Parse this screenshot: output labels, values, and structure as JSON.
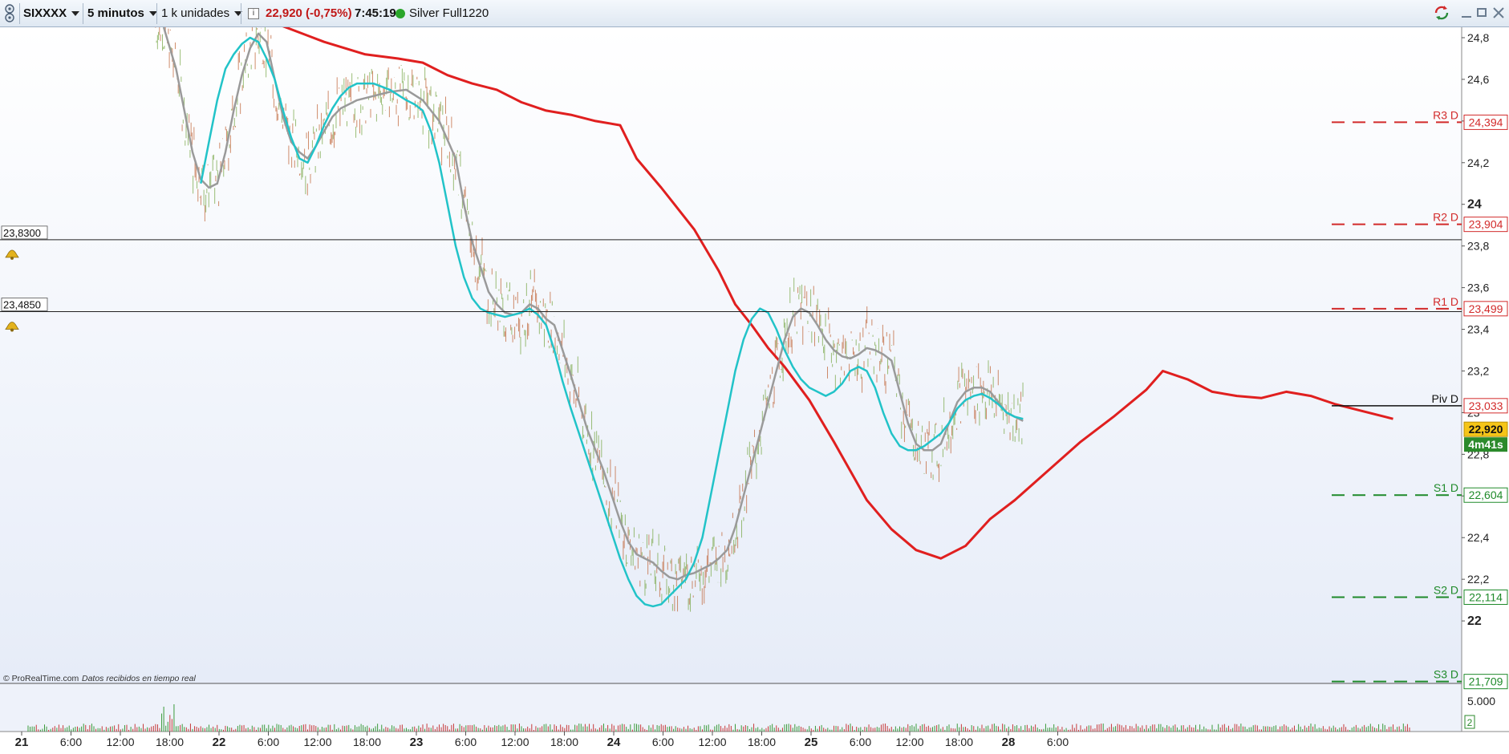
{
  "toolbar": {
    "logo_icon": "prorealtime-logo-icon",
    "symbol": "SIXXXX",
    "timeframe": "5 minutos",
    "units": "1 k unidades",
    "info_icon": "info-icon",
    "price_change": "22,920 (-0,75%)",
    "time": "7:45:19",
    "status_icon": "green-dot-icon",
    "account": "Silver Full1220",
    "window_icons": [
      "refresh-icon",
      "minimize-icon",
      "maximize-icon",
      "close-icon"
    ]
  },
  "colors": {
    "chart_bg_top": "#ffffff",
    "chart_bg_bottom": "#e8edf9",
    "red_ma": "#e01f1f",
    "gray_ma": "#9a9a9a",
    "cyan_ma": "#22c3c8",
    "dotted_ma": "#1a1aa8",
    "resistance": "#d22a2a",
    "support": "#1f8a2a",
    "price_badge": "#f5c518",
    "countdown_badge": "#2b8a2b",
    "negative_change": "#c01616"
  },
  "chart_data": {
    "type": "line",
    "title": "",
    "x_labels": [
      "21",
      "6:00",
      "12:00",
      "18:00",
      "22",
      "6:00",
      "12:00",
      "18:00",
      "23",
      "6:00",
      "12:00",
      "18:00",
      "24",
      "6:00",
      "12:00",
      "18:00",
      "25",
      "6:00",
      "12:00",
      "18:00",
      "28",
      "6:00"
    ],
    "bold_x_labels": [
      "21",
      "22",
      "23",
      "24",
      "25",
      "28"
    ],
    "y_ticks": [
      "24,8",
      "24,6",
      "24,4",
      "24,2",
      "24",
      "23,8",
      "23,6",
      "23,4",
      "23,2",
      "23",
      "22,8",
      "22,6",
      "22,4",
      "22,2",
      "22"
    ],
    "ylim": [
      21.7,
      24.85
    ],
    "x_range_hours": [
      0,
      171
    ],
    "series": [
      {
        "key": "red",
        "style": "solid",
        "values": [
          [
            15.5,
            25.6
          ],
          [
            16.5,
            25.4
          ],
          [
            19,
            25.2
          ],
          [
            23,
            24.98
          ],
          [
            27,
            24.92
          ],
          [
            30,
            24.87
          ],
          [
            36,
            24.78
          ],
          [
            41,
            24.72
          ],
          [
            45,
            24.7
          ],
          [
            48,
            24.68
          ],
          [
            51,
            24.62
          ],
          [
            54,
            24.58
          ],
          [
            57,
            24.55
          ],
          [
            60,
            24.49
          ],
          [
            63,
            24.45
          ],
          [
            66,
            24.43
          ],
          [
            69,
            24.4
          ],
          [
            72,
            24.38
          ],
          [
            74,
            24.22
          ],
          [
            77,
            24.08
          ],
          [
            79,
            23.98
          ],
          [
            81,
            23.88
          ],
          [
            84,
            23.68
          ],
          [
            86,
            23.52
          ],
          [
            88,
            23.42
          ],
          [
            90,
            23.31
          ],
          [
            92,
            23.22
          ],
          [
            95,
            23.06
          ],
          [
            98,
            22.86
          ],
          [
            100,
            22.72
          ],
          [
            102,
            22.58
          ],
          [
            105,
            22.44
          ],
          [
            108,
            22.34
          ],
          [
            111,
            22.3
          ],
          [
            114,
            22.36
          ],
          [
            117,
            22.49
          ],
          [
            120,
            22.58
          ],
          [
            124,
            22.72
          ],
          [
            128,
            22.86
          ],
          [
            132,
            22.98
          ],
          [
            136,
            23.11
          ],
          [
            138,
            23.2
          ],
          [
            141,
            23.16
          ],
          [
            144,
            23.1
          ],
          [
            147,
            23.08
          ],
          [
            150,
            23.07
          ],
          [
            153,
            23.1
          ],
          [
            156,
            23.08
          ],
          [
            159,
            23.04
          ],
          [
            162,
            23.01
          ],
          [
            165,
            22.98
          ],
          [
            166,
            22.97
          ]
        ]
      },
      {
        "key": "gray",
        "style": "solid",
        "values": [
          [
            16.5,
            24.85
          ],
          [
            18,
            24.65
          ],
          [
            19,
            24.45
          ],
          [
            20,
            24.25
          ],
          [
            21,
            24.12
          ],
          [
            22,
            24.08
          ],
          [
            23,
            24.1
          ],
          [
            24,
            24.25
          ],
          [
            25,
            24.45
          ],
          [
            26,
            24.62
          ],
          [
            27,
            24.75
          ],
          [
            28,
            24.82
          ],
          [
            29,
            24.78
          ],
          [
            30,
            24.6
          ],
          [
            31,
            24.42
          ],
          [
            32,
            24.3
          ],
          [
            33,
            24.25
          ],
          [
            34,
            24.22
          ],
          [
            35,
            24.28
          ],
          [
            36,
            24.35
          ],
          [
            37,
            24.42
          ],
          [
            38,
            24.46
          ],
          [
            40,
            24.5
          ],
          [
            42,
            24.52
          ],
          [
            44,
            24.54
          ],
          [
            46,
            24.55
          ],
          [
            48,
            24.5
          ],
          [
            50,
            24.4
          ],
          [
            52,
            24.22
          ],
          [
            53,
            24.0
          ],
          [
            54,
            23.82
          ],
          [
            55,
            23.7
          ],
          [
            56,
            23.58
          ],
          [
            57,
            23.52
          ],
          [
            58,
            23.48
          ],
          [
            59,
            23.47
          ],
          [
            60,
            23.48
          ],
          [
            61,
            23.52
          ],
          [
            62,
            23.5
          ],
          [
            63,
            23.45
          ],
          [
            64,
            23.42
          ],
          [
            65,
            23.3
          ],
          [
            66,
            23.18
          ],
          [
            67,
            23.05
          ],
          [
            68,
            22.92
          ],
          [
            69,
            22.82
          ],
          [
            70,
            22.72
          ],
          [
            71,
            22.6
          ],
          [
            72,
            22.48
          ],
          [
            73,
            22.38
          ],
          [
            74,
            22.32
          ],
          [
            75,
            22.3
          ],
          [
            76,
            22.28
          ],
          [
            77,
            22.24
          ],
          [
            78,
            22.21
          ],
          [
            79,
            22.2
          ],
          [
            80,
            22.22
          ],
          [
            81,
            22.23
          ],
          [
            82,
            22.25
          ],
          [
            83,
            22.27
          ],
          [
            84,
            22.3
          ],
          [
            85,
            22.34
          ],
          [
            86,
            22.45
          ],
          [
            87,
            22.6
          ],
          [
            88,
            22.75
          ],
          [
            89,
            22.9
          ],
          [
            90,
            23.05
          ],
          [
            91,
            23.2
          ],
          [
            92,
            23.35
          ],
          [
            93,
            23.46
          ],
          [
            94,
            23.5
          ],
          [
            95,
            23.48
          ],
          [
            96,
            23.42
          ],
          [
            97,
            23.35
          ],
          [
            98,
            23.3
          ],
          [
            99,
            23.27
          ],
          [
            100,
            23.26
          ],
          [
            101,
            23.28
          ],
          [
            102,
            23.31
          ],
          [
            103,
            23.3
          ],
          [
            104,
            23.28
          ],
          [
            105,
            23.25
          ],
          [
            106,
            23.1
          ],
          [
            107,
            22.95
          ],
          [
            108,
            22.85
          ],
          [
            109,
            22.82
          ],
          [
            110,
            22.82
          ],
          [
            111,
            22.85
          ],
          [
            112,
            22.95
          ],
          [
            113,
            23.05
          ],
          [
            114,
            23.1
          ],
          [
            115,
            23.12
          ],
          [
            116,
            23.12
          ],
          [
            117,
            23.1
          ],
          [
            118,
            23.05
          ],
          [
            119,
            23.0
          ],
          [
            120,
            22.98
          ],
          [
            121,
            22.96
          ]
        ]
      },
      {
        "key": "cyan",
        "style": "solid",
        "values": [
          [
            21,
            24.1
          ],
          [
            22,
            24.3
          ],
          [
            23,
            24.5
          ],
          [
            24,
            24.65
          ],
          [
            25,
            24.72
          ],
          [
            26,
            24.77
          ],
          [
            27,
            24.8
          ],
          [
            28,
            24.78
          ],
          [
            29,
            24.7
          ],
          [
            30,
            24.6
          ],
          [
            31,
            24.45
          ],
          [
            32,
            24.32
          ],
          [
            33,
            24.22
          ],
          [
            34,
            24.2
          ],
          [
            35,
            24.28
          ],
          [
            36,
            24.38
          ],
          [
            37,
            24.46
          ],
          [
            38,
            24.52
          ],
          [
            39,
            24.56
          ],
          [
            40,
            24.58
          ],
          [
            42,
            24.58
          ],
          [
            44,
            24.55
          ],
          [
            46,
            24.5
          ],
          [
            47,
            24.48
          ],
          [
            48,
            24.45
          ],
          [
            49,
            24.35
          ],
          [
            50,
            24.2
          ],
          [
            51,
            24.0
          ],
          [
            52,
            23.8
          ],
          [
            53,
            23.65
          ],
          [
            54,
            23.55
          ],
          [
            55,
            23.5
          ],
          [
            56,
            23.48
          ],
          [
            57,
            23.47
          ],
          [
            58,
            23.46
          ],
          [
            59,
            23.47
          ],
          [
            60,
            23.48
          ],
          [
            61,
            23.5
          ],
          [
            62,
            23.47
          ],
          [
            63,
            23.42
          ],
          [
            64,
            23.3
          ],
          [
            65,
            23.15
          ],
          [
            66,
            23.02
          ],
          [
            67,
            22.9
          ],
          [
            68,
            22.78
          ],
          [
            69,
            22.66
          ],
          [
            70,
            22.54
          ],
          [
            71,
            22.42
          ],
          [
            72,
            22.3
          ],
          [
            73,
            22.2
          ],
          [
            74,
            22.12
          ],
          [
            75,
            22.08
          ],
          [
            76,
            22.07
          ],
          [
            77,
            22.08
          ],
          [
            78,
            22.12
          ],
          [
            79,
            22.16
          ],
          [
            80,
            22.2
          ],
          [
            81,
            22.28
          ],
          [
            82,
            22.4
          ],
          [
            83,
            22.6
          ],
          [
            84,
            22.8
          ],
          [
            85,
            23.0
          ],
          [
            86,
            23.2
          ],
          [
            87,
            23.35
          ],
          [
            88,
            23.45
          ],
          [
            89,
            23.5
          ],
          [
            90,
            23.48
          ],
          [
            91,
            23.4
          ],
          [
            92,
            23.3
          ],
          [
            93,
            23.22
          ],
          [
            94,
            23.16
          ],
          [
            95,
            23.12
          ],
          [
            96,
            23.1
          ],
          [
            97,
            23.08
          ],
          [
            98,
            23.1
          ],
          [
            99,
            23.14
          ],
          [
            100,
            23.2
          ],
          [
            101,
            23.22
          ],
          [
            102,
            23.2
          ],
          [
            103,
            23.12
          ],
          [
            104,
            23.0
          ],
          [
            105,
            22.9
          ],
          [
            106,
            22.84
          ],
          [
            107,
            22.82
          ],
          [
            108,
            22.82
          ],
          [
            109,
            22.84
          ],
          [
            110,
            22.87
          ],
          [
            111,
            22.9
          ],
          [
            112,
            22.95
          ],
          [
            113,
            23.02
          ],
          [
            114,
            23.06
          ],
          [
            115,
            23.08
          ],
          [
            116,
            23.09
          ],
          [
            117,
            23.07
          ],
          [
            118,
            23.04
          ],
          [
            119,
            23.0
          ],
          [
            120,
            22.98
          ],
          [
            121,
            22.97
          ]
        ]
      }
    ],
    "horizontal_lines": [
      {
        "label": "23,8300",
        "value": 23.83
      },
      {
        "label": "23,4850",
        "value": 23.485
      }
    ],
    "pivot_levels": [
      {
        "name": "R3 D",
        "value": 24.394,
        "label": "24,394",
        "color_key": "resistance"
      },
      {
        "name": "R2 D",
        "value": 23.904,
        "label": "23,904",
        "color_key": "resistance"
      },
      {
        "name": "R1 D",
        "value": 23.499,
        "label": "23,499",
        "color_key": "resistance"
      },
      {
        "name": "Piv D",
        "value": 23.033,
        "label": "23,033",
        "color_key": "resistance"
      },
      {
        "name": "S1 D",
        "value": 22.604,
        "label": "22,604",
        "color_key": "support"
      },
      {
        "name": "S2 D",
        "value": 22.114,
        "label": "22,114",
        "color_key": "support"
      },
      {
        "name": "S3 D",
        "value": 21.709,
        "label": "21,709",
        "color_key": "support"
      }
    ],
    "last_price_label": "22,920",
    "last_price_value": 22.92,
    "countdown": "4m41s",
    "volume_tick": "5.000",
    "volume_small_badge": "2",
    "copyright": "© ProRealTime.com",
    "feed_status": "Datos recibidos en tiempo real",
    "alert_icon": "bell-icon"
  }
}
